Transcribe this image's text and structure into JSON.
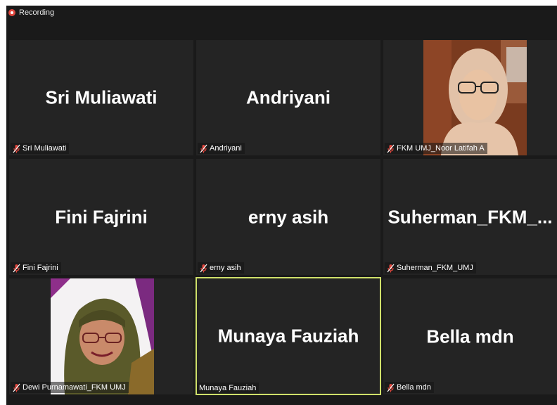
{
  "status": {
    "recording_label": "Recording"
  },
  "tiles": [
    {
      "name": "Sri Muliawati",
      "label": "Sri Muliawati",
      "muted": true
    },
    {
      "name": "Andriyani",
      "label": "Andriyani",
      "muted": true
    },
    {
      "label": "FKM UMJ_Noor Latifah A",
      "muted": true,
      "video": true
    },
    {
      "name": "Fini Fajrini",
      "label": "Fini Fajrini",
      "muted": true
    },
    {
      "name": "erny asih",
      "label": "erny asih",
      "muted": true
    },
    {
      "name": "Suherman_FKM_...",
      "label": "Suherman_FKM_UMJ",
      "muted": true
    },
    {
      "label": "Dewi Purnamawati_FKM UMJ",
      "muted": true,
      "video": true
    },
    {
      "name": "Munaya Fauziah",
      "label": "Munaya Fauziah",
      "muted": false,
      "active_speaker": true
    },
    {
      "name": "Bella mdn",
      "label": "Bella mdn",
      "muted": true
    }
  ],
  "colors": {
    "active_speaker_border": "#cfe06a",
    "muted_mic": "#e0463d",
    "tile_bg": "#242424",
    "background": "#1a1a1a"
  }
}
